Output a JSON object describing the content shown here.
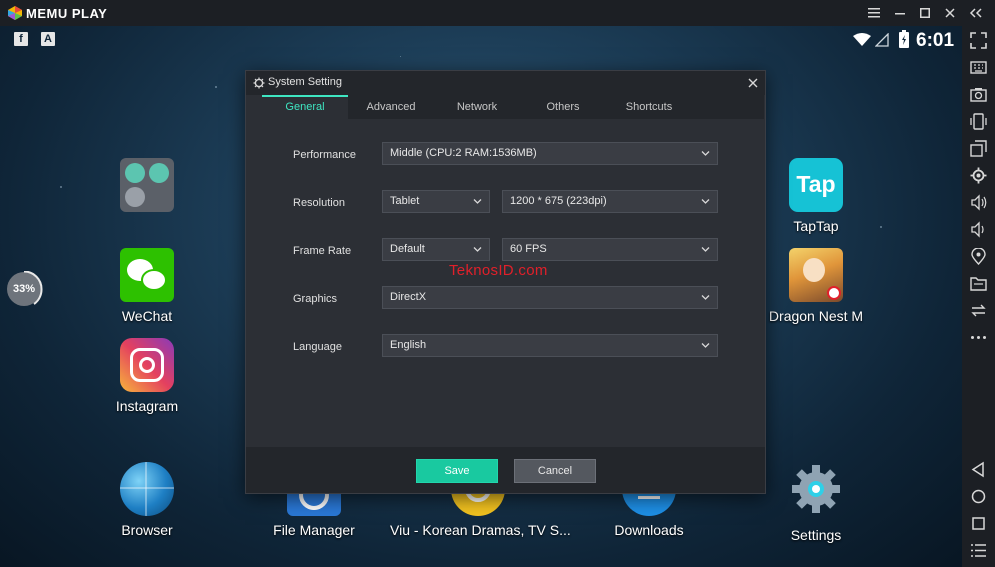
{
  "app": {
    "title": "MEMU PLAY",
    "brand_color": "#3ee6c2"
  },
  "window_controls": {
    "menu_icon": "hamburger-icon",
    "minimize_icon": "minimize-icon",
    "maximize_icon": "maximize-icon",
    "close_icon": "close-icon",
    "collapse_icon": "double-chevron-left-icon"
  },
  "status_bar": {
    "left_icons": [
      "facebook-icon",
      "a-letter-icon"
    ],
    "right_icons": [
      "wifi-icon",
      "signal-icon",
      "battery-icon"
    ],
    "time": "6:01"
  },
  "desktop": {
    "progress_percent": 33,
    "progress_label": "33%",
    "apps_left": [
      {
        "label": "",
        "icon": "google-apps-folder-icon"
      },
      {
        "label": "WeChat",
        "icon": "wechat-icon"
      },
      {
        "label": "Instagram",
        "icon": "instagram-icon"
      },
      {
        "label": "Browser",
        "icon": "globe-icon"
      }
    ],
    "apps_right": [
      {
        "label": "TapTap",
        "icon": "taptap-icon",
        "tile_text": "Tap"
      },
      {
        "label": "Dragon Nest M",
        "icon": "dragon-nest-icon"
      },
      {
        "label": "Settings",
        "icon": "settings-gear-icon"
      }
    ],
    "apps_bottom": [
      {
        "label": "File Manager",
        "icon": "file-manager-icon"
      },
      {
        "label": "Viu - Korean Dramas, TV S...",
        "icon": "viu-icon"
      },
      {
        "label": "Downloads",
        "icon": "downloads-icon"
      }
    ]
  },
  "sidebar": {
    "icons": [
      "fullscreen-icon",
      "keyboard-icon",
      "screenshot-icon",
      "shake-icon",
      "multi-window-icon",
      "settings-icon",
      "volume-up-icon",
      "volume-down-icon",
      "location-icon",
      "folder-icon",
      "rotate-icon",
      "more-icon",
      "back-icon",
      "home-icon",
      "recent-apps-icon",
      "menu-list-icon"
    ]
  },
  "dialog": {
    "title": "System Setting",
    "tabs": [
      {
        "label": "General",
        "active": true
      },
      {
        "label": "Advanced",
        "active": false
      },
      {
        "label": "Network",
        "active": false
      },
      {
        "label": "Others",
        "active": false
      },
      {
        "label": "Shortcuts",
        "active": false
      }
    ],
    "performance": {
      "label": "Performance",
      "value": "Middle (CPU:2 RAM:1536MB)"
    },
    "resolution": {
      "label": "Resolution",
      "mode": "Tablet",
      "value": "1200 * 675 (223dpi)"
    },
    "frame_rate": {
      "label": "Frame Rate",
      "mode": "Default",
      "value": "60 FPS"
    },
    "graphics": {
      "label": "Graphics",
      "value": "DirectX"
    },
    "language": {
      "label": "Language",
      "value": "English"
    },
    "save_label": "Save",
    "cancel_label": "Cancel"
  },
  "watermark": "TeknosID.com"
}
